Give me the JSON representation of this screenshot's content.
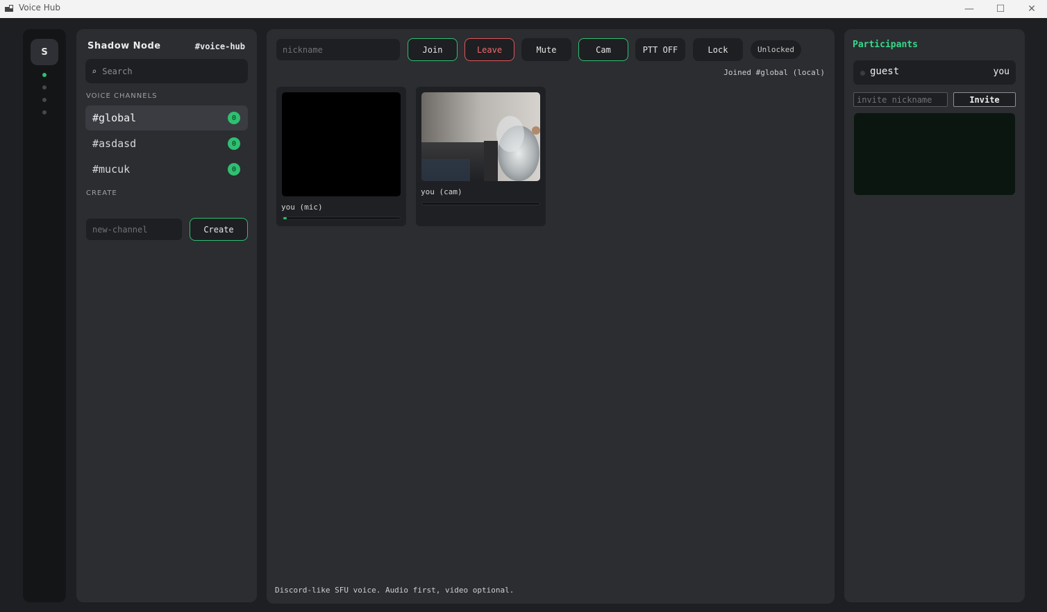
{
  "window": {
    "title": "Voice Hub",
    "minimize_glyph": "—",
    "maximize_glyph": "☐",
    "close_glyph": "✕"
  },
  "rail": {
    "avatar_letter": "S",
    "dots": 4,
    "active_dot": 0
  },
  "sidebar": {
    "server_name": "Shadow Node",
    "hub_tag": "#voice-hub",
    "search_placeholder": "Search",
    "search_icon": "search-icon",
    "voice_section_label": "VOICE CHANNELS",
    "channels": [
      {
        "name": "#global",
        "count": "0",
        "active": true
      },
      {
        "name": "#asdasd",
        "count": "0",
        "active": false
      },
      {
        "name": "#mucuk",
        "count": "0",
        "active": false
      }
    ],
    "create_section_label": "CREATE",
    "new_channel_placeholder": "new-channel",
    "create_label": "Create"
  },
  "toolbar": {
    "nickname_placeholder": "nickname",
    "join_label": "Join",
    "leave_label": "Leave",
    "mute_label": "Mute",
    "cam_label": "Cam",
    "ptt_label": "PTT OFF",
    "lock_label": "Lock",
    "lock_state": "Unlocked"
  },
  "status": {
    "joined_text": "Joined #global (local)"
  },
  "tiles": [
    {
      "label": "you (mic)",
      "level": 0.03
    },
    {
      "label": "you (cam)",
      "level": 0.0
    }
  ],
  "footer": {
    "text": "Discord-like SFU voice. Audio first, video optional."
  },
  "participants": {
    "heading": "Participants",
    "list": [
      {
        "name": "guest",
        "tag": "you"
      }
    ],
    "invite_placeholder": "invite nickname",
    "invite_label": "Invite"
  },
  "colors": {
    "accent_green": "#2fbf71",
    "heading_green": "#37d98a",
    "danger_red": "#e0545a",
    "panel_bg": "#2b2d31",
    "app_bg": "#1e1f22"
  }
}
